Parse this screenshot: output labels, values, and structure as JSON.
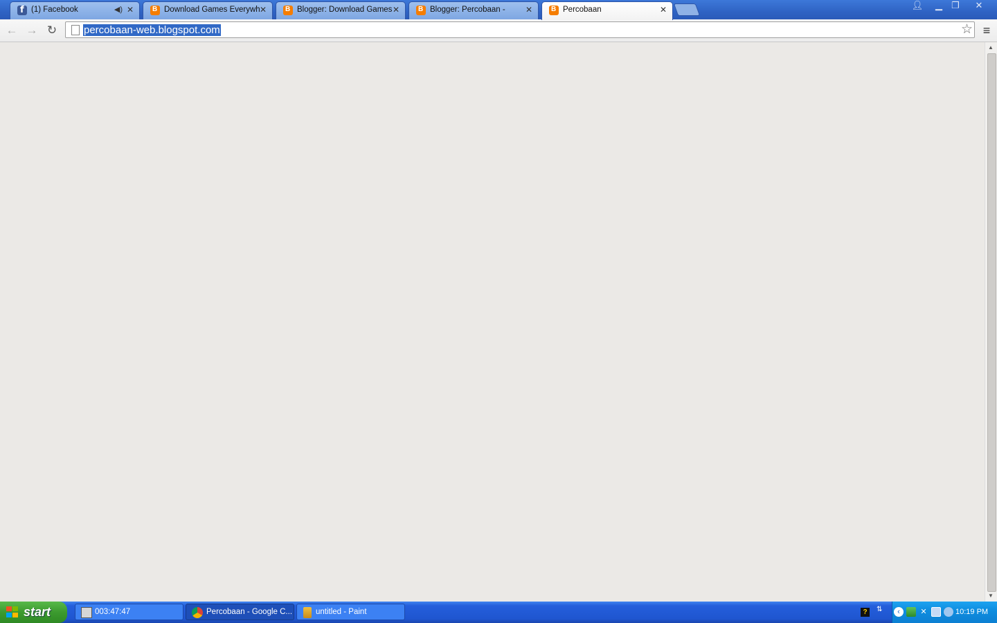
{
  "browser": {
    "tabs": [
      {
        "title": "(1) Facebook",
        "favicon": "facebook-icon",
        "audio": true
      },
      {
        "title": "Download Games Everywher",
        "favicon": "blogger-icon"
      },
      {
        "title": "Blogger: Download Games Ev",
        "favicon": "blogger-icon"
      },
      {
        "title": "Blogger: Percobaan -",
        "favicon": "blogger-icon"
      },
      {
        "title": "Percobaan",
        "favicon": "blogger-icon",
        "active": true
      }
    ],
    "address": "percobaan-web.blogspot.com",
    "icons": {
      "back": "back-arrow-icon",
      "forward": "forward-arrow-icon",
      "reload": "reload-icon",
      "star": "bookmark-star-icon",
      "menu": "hamburger-menu-icon",
      "close": "close-icon"
    }
  },
  "taskbar": {
    "start_label": "start",
    "tasks": [
      {
        "label": "003:47:47",
        "icon": "monitor-icon"
      },
      {
        "label": "Percobaan - Google C...",
        "icon": "chrome-icon",
        "active": true
      },
      {
        "label": "untitled - Paint",
        "icon": "paint-icon"
      }
    ],
    "tray": {
      "help_label": "?",
      "clock": "10:19 PM"
    }
  },
  "colors": {
    "xp_blue": "#245edb",
    "start_green": "#3c9a2f",
    "selection": "#3169c6",
    "page_bg": "#ebe9e6"
  }
}
